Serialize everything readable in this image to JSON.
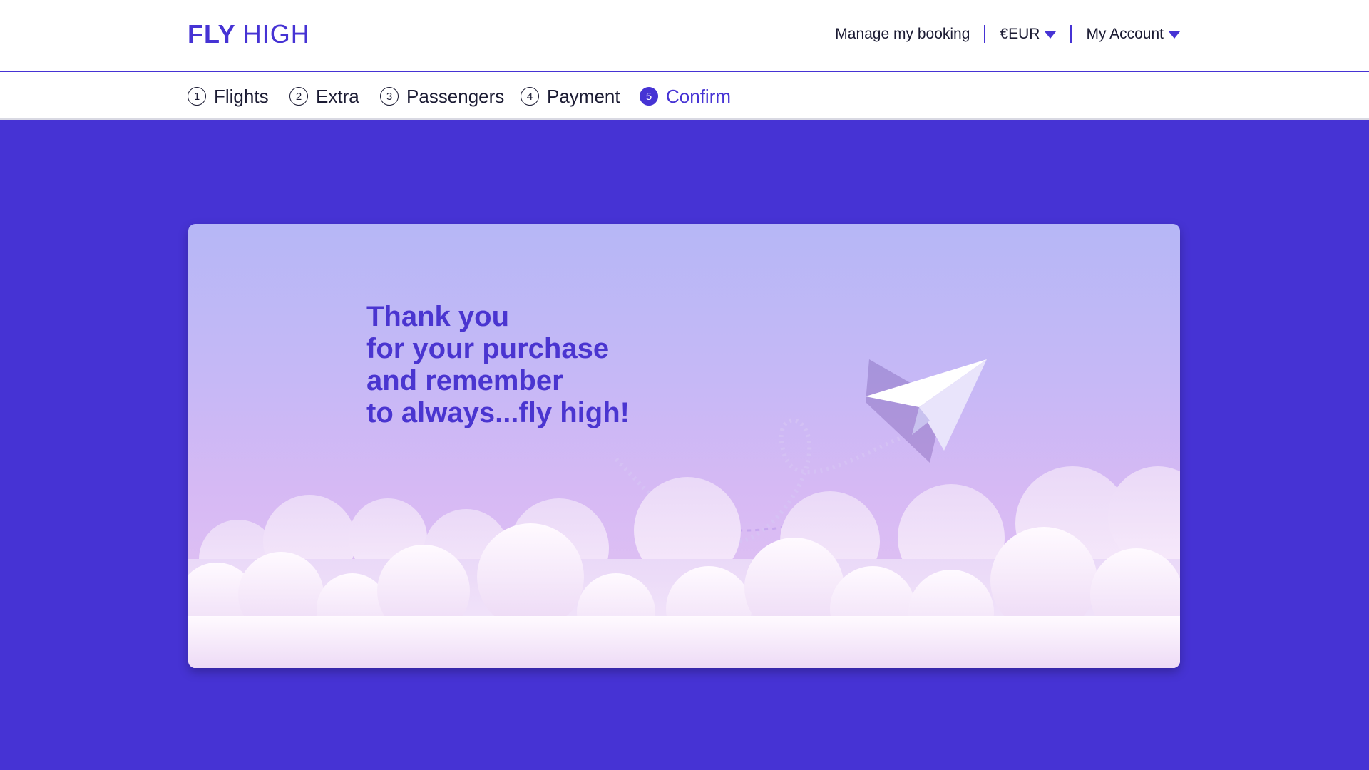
{
  "brand": {
    "bold": "FLY",
    "light": "HIGH",
    "color": "#4633d4"
  },
  "topnav": {
    "manage": "Manage my booking",
    "currency": "€EUR",
    "account": "My Account"
  },
  "steps": [
    {
      "num": "1",
      "label": "Flights"
    },
    {
      "num": "2",
      "label": "Extra"
    },
    {
      "num": "3",
      "label": "Passengers"
    },
    {
      "num": "4",
      "label": "Payment"
    },
    {
      "num": "5",
      "label": "Confirm",
      "active": true
    }
  ],
  "confirmation": {
    "lines": [
      "Thank you",
      "for your purchase",
      "and remember",
      "to always...fly high!"
    ]
  },
  "icons": [
    "caret-down-icon",
    "paper-plane-icon",
    "clouds-illustration"
  ],
  "colors": {
    "accent": "#4633d4",
    "text": "#1b1b33",
    "background": "#4633d4"
  }
}
